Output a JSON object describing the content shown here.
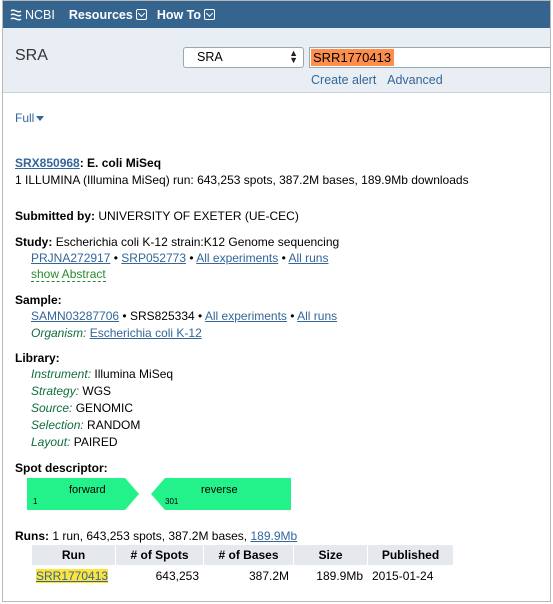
{
  "header": {
    "logo_text": "NCBI",
    "menus": [
      {
        "label": "Resources"
      },
      {
        "label": "How To"
      }
    ]
  },
  "search": {
    "db_title": "SRA",
    "db_selected": "SRA",
    "term": "SRR1770413",
    "links": [
      "Create alert",
      "Advanced"
    ]
  },
  "view": {
    "format": "Full"
  },
  "record": {
    "accession": "SRX850968",
    "title_rest": ": E. coli MiSeq",
    "summary": "1 ILLUMINA (Illumina MiSeq) run: 643,253 spots, 387.2M bases, 189.9Mb downloads",
    "submitted_label": "Submitted by:",
    "submitted_value": "UNIVERSITY OF EXETER (UE-CEC)",
    "study_label": "Study:",
    "study_value": "Escherichia coli K-12 strain:K12 Genome sequencing",
    "study_links": {
      "bioproject": "PRJNA272917",
      "sep": "•",
      "srp": "SRP052773",
      "all_experiments": "All experiments",
      "all_runs": "All runs"
    },
    "show_abstract": "show Abstract",
    "sample_label": "Sample:",
    "sample_links": {
      "biosample": "SAMN03287706",
      "srs": "SRS825334",
      "all_experiments": "All experiments",
      "all_runs": "All runs"
    },
    "organism_label": "Organism:",
    "organism_value": "Escherichia coli K-12",
    "library_label": "Library:",
    "library": [
      {
        "label": "Instrument:",
        "value": "Illumina MiSeq"
      },
      {
        "label": "Strategy:",
        "value": "WGS"
      },
      {
        "label": "Source:",
        "value": "GENOMIC"
      },
      {
        "label": "Selection:",
        "value": "RANDOM"
      },
      {
        "label": "Layout:",
        "value": "PAIRED"
      }
    ],
    "spot_label": "Spot descriptor:",
    "spot": {
      "read1_pos": "1",
      "read1_label": "forward",
      "read2_pos": "301",
      "read2_label": "reverse",
      "color": "#23f18a"
    },
    "runs_label": "Runs:",
    "runs_summary": "1 run, 643,253 spots, 387.2M bases,",
    "runs_download": "189.9Mb"
  },
  "runs_table": {
    "headers": [
      "Run",
      "# of Spots",
      "# of Bases",
      "Size",
      "Published"
    ],
    "rows": [
      {
        "run": "SRR1770413",
        "spots": "643,253",
        "bases": "387.2M",
        "size": "189.9Mb",
        "published": "2015-01-24"
      }
    ]
  },
  "colors": {
    "topbar": "#35658f",
    "link": "#33669a",
    "search_highlight": "#fd8e4b",
    "run_highlight": "#fde33a"
  }
}
